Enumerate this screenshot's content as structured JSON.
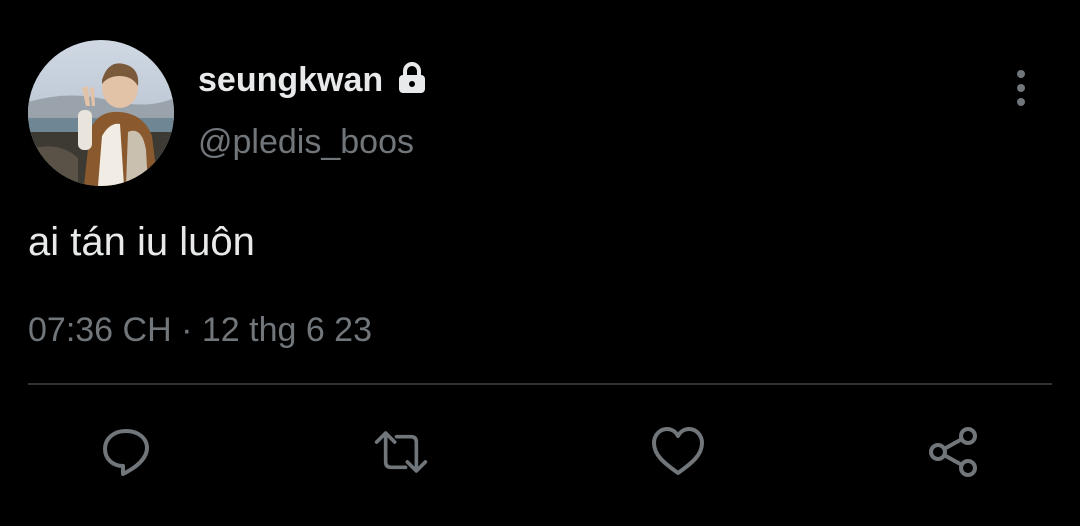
{
  "tweet": {
    "author": {
      "display_name": "seungkwan",
      "handle": "@pledis_boos",
      "protected": true,
      "avatar_icon": "profile-photo"
    },
    "text": "ai tán iu luôn",
    "timestamp": "07:36 CH · 12 thg 6 23"
  },
  "actions": {
    "reply_icon": "reply-icon",
    "retweet_icon": "retweet-icon",
    "like_icon": "heart-icon",
    "share_icon": "share-icon"
  },
  "colors": {
    "background": "#000000",
    "primary_text": "#e7e9ea",
    "secondary_text": "#71767b",
    "divider": "#2f3336"
  }
}
